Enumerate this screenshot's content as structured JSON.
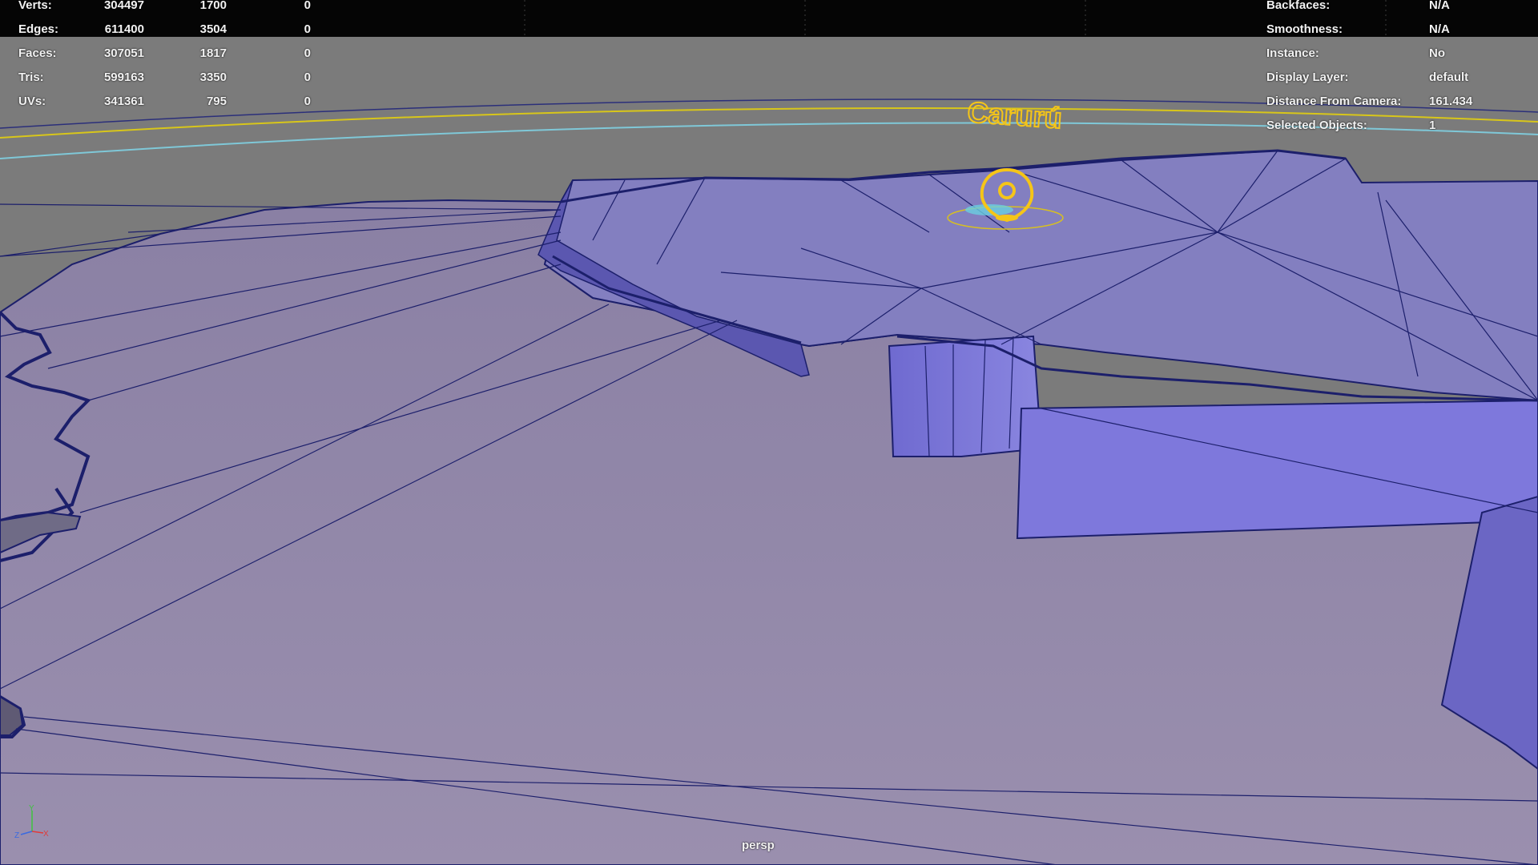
{
  "hud_left": {
    "rows": [
      {
        "label": "Verts:",
        "c1": "304497",
        "c2": "1700",
        "c3": "0"
      },
      {
        "label": "Edges:",
        "c1": "611400",
        "c2": "3504",
        "c3": "0"
      },
      {
        "label": "Faces:",
        "c1": "307051",
        "c2": "1817",
        "c3": "0"
      },
      {
        "label": "Tris:",
        "c1": "599163",
        "c2": "3350",
        "c3": "0"
      },
      {
        "label": "UVs:",
        "c1": "341361",
        "c2": "795",
        "c3": "0"
      }
    ]
  },
  "hud_right": {
    "rows": [
      {
        "label": "Backfaces:",
        "value": "N/A"
      },
      {
        "label": "Smoothness:",
        "value": "N/A"
      },
      {
        "label": "Instance:",
        "value": "No"
      },
      {
        "label": "Display Layer:",
        "value": "default"
      },
      {
        "label": "Distance From Camera:",
        "value": "161.434"
      },
      {
        "label": "Selected Objects:",
        "value": "1"
      }
    ]
  },
  "scene": {
    "map_label": "Carurú",
    "pin_icon": "location-pin-icon"
  },
  "camera": {
    "name": "persp"
  },
  "axis": {
    "x": "X",
    "y": "Y",
    "z": "Z"
  },
  "colors": {
    "background_top": "#7b7b7b",
    "header_band": "#000000",
    "terrain_fill": "#9488ab",
    "region_fill": "#7d79d4",
    "wireframe": "#1c1f6b",
    "selection_yellow": "#f5c518",
    "curve_cyan": "#6ad0e0"
  }
}
